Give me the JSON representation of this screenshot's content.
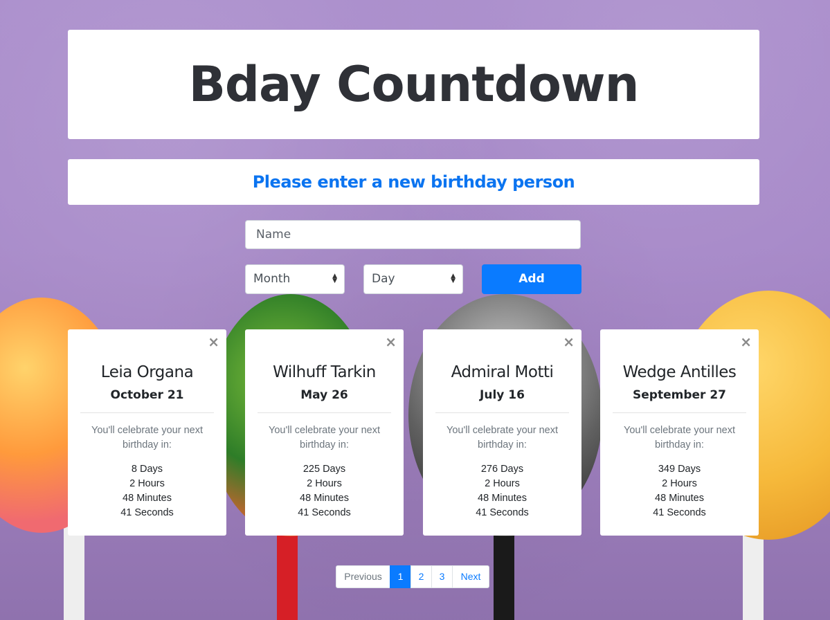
{
  "header": {
    "title": "Bday Countdown",
    "subtitle": "Please enter a new birthday person"
  },
  "form": {
    "name_placeholder": "Name",
    "month_selected": "Month",
    "day_selected": "Day",
    "add_label": "Add"
  },
  "cards": [
    {
      "name": "Leia Organa",
      "date": "October 21",
      "message": "You'll celebrate your next birthday in:",
      "days": "8 Days",
      "hours": "2 Hours",
      "minutes": "48 Minutes",
      "seconds": "41 Seconds",
      "close": "×"
    },
    {
      "name": "Wilhuff Tarkin",
      "date": "May 26",
      "message": "You'll celebrate your next birthday in:",
      "days": "225 Days",
      "hours": "2 Hours",
      "minutes": "48 Minutes",
      "seconds": "41 Seconds",
      "close": "×"
    },
    {
      "name": "Admiral Motti",
      "date": "July 16",
      "message": "You'll celebrate your next birthday in:",
      "days": "276 Days",
      "hours": "2 Hours",
      "minutes": "48 Minutes",
      "seconds": "41 Seconds",
      "close": "×"
    },
    {
      "name": "Wedge Antilles",
      "date": "September 27",
      "message": "You'll celebrate your next birthday in:",
      "days": "349 Days",
      "hours": "2 Hours",
      "minutes": "48 Minutes",
      "seconds": "41 Seconds",
      "close": "×"
    }
  ],
  "pagination": {
    "previous": "Previous",
    "pages": [
      "1",
      "2",
      "3"
    ],
    "active_page": "1",
    "next": "Next"
  },
  "colors": {
    "accent": "#0a7bff",
    "title_text": "#2f3137",
    "subtitle_text": "#0b74f0",
    "background": "#a688c8"
  },
  "icons": {
    "close": "close-icon",
    "select_arrows": "select-arrows-icon"
  }
}
